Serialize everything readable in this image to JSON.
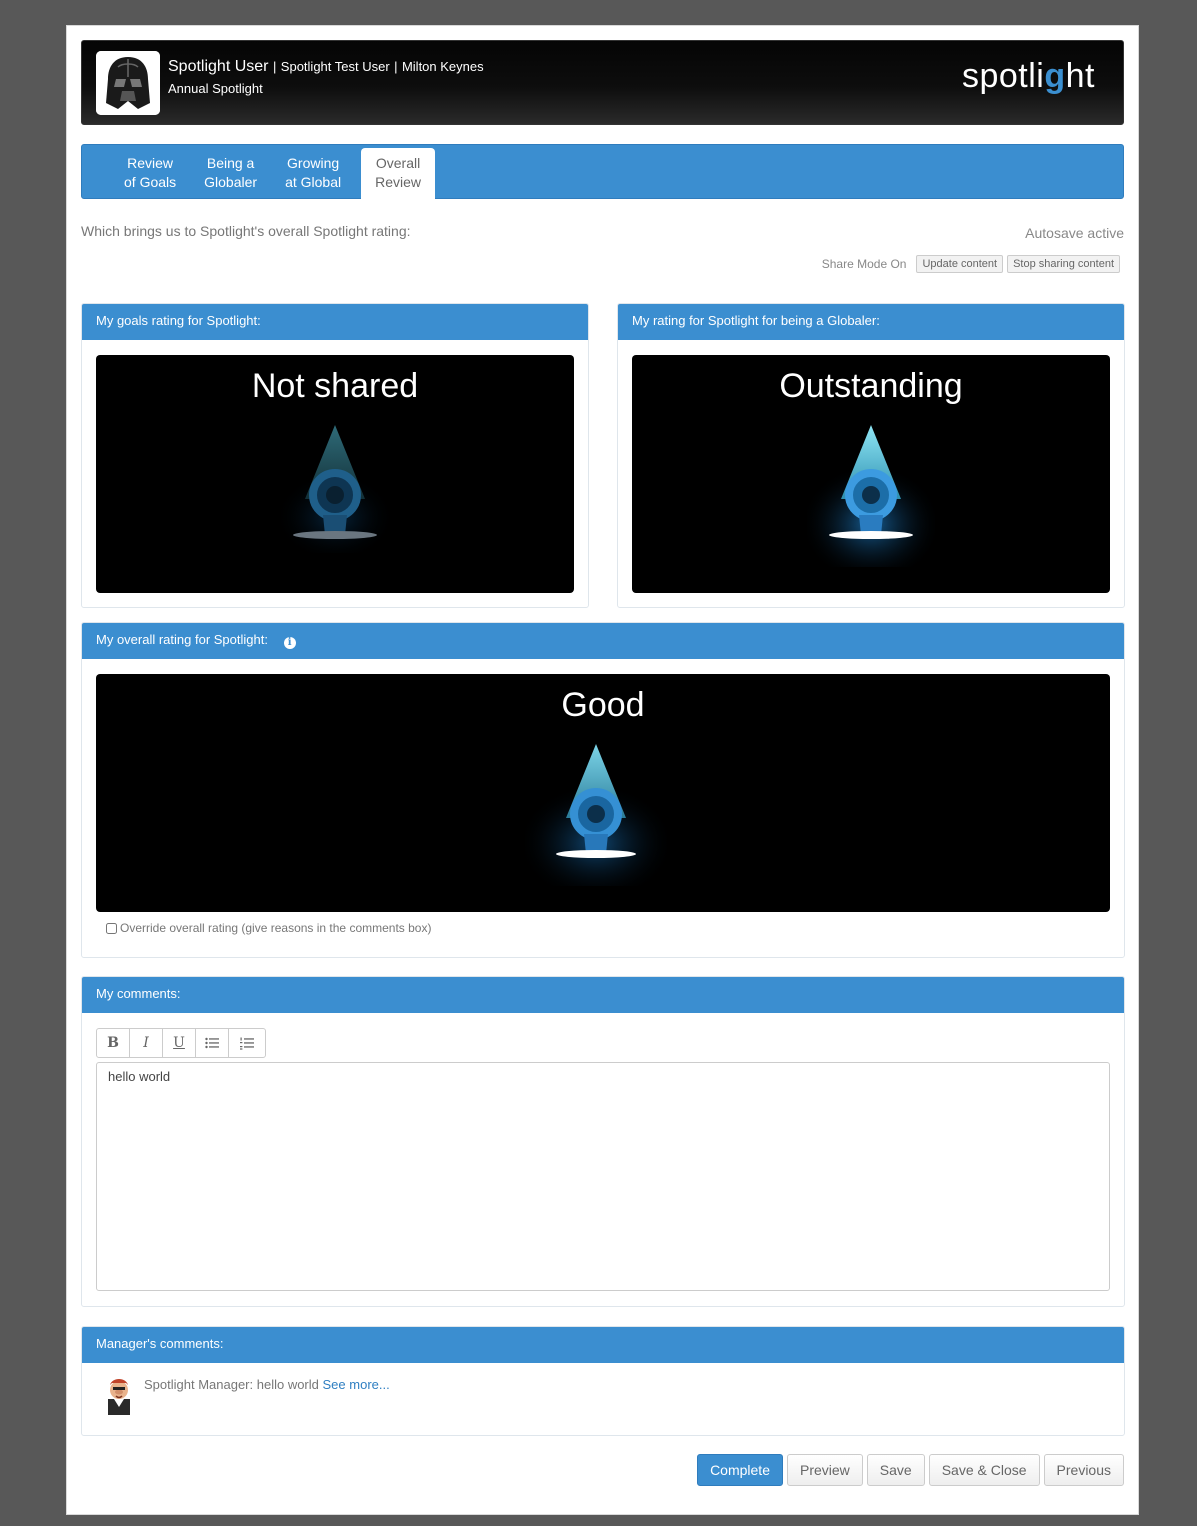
{
  "header": {
    "user_name": "Spotlight User",
    "test_user": "Spotlight Test User",
    "location": "Milton Keynes",
    "separator": "|",
    "review_type": "Annual Spotlight",
    "logo_left": "spotli",
    "logo_g": "g",
    "logo_right": "ht"
  },
  "tabs": [
    {
      "line1": "Review",
      "line2": "of Goals"
    },
    {
      "line1": "Being a",
      "line2": "Globaler"
    },
    {
      "line1": "Growing",
      "line2": "at Global"
    },
    {
      "line1": "Overall",
      "line2": "Review",
      "active": true
    }
  ],
  "intro_text": "Which brings us to Spotlight's overall Spotlight rating:",
  "autosave": "Autosave active",
  "share": {
    "label": "Share Mode On",
    "update_label": "Update content",
    "stop_label": "Stop sharing content"
  },
  "goals_panel": {
    "title": "My goals rating for Spotlight:",
    "rating": "Not shared"
  },
  "globaler_panel": {
    "title": "My rating for Spotlight for being a Globaler:",
    "rating": "Outstanding"
  },
  "overall_panel": {
    "title": "My overall rating for Spotlight:",
    "info_icon": "info-icon",
    "rating": "Good",
    "override_label": "Override overall rating (give reasons in the comments box)"
  },
  "comments_panel": {
    "title": "My comments:",
    "toolbar": [
      "B",
      "I",
      "U"
    ],
    "text": "hello world"
  },
  "manager_panel": {
    "title": "Manager's comments:",
    "comment": "Spotlight Manager: hello world",
    "see_more": "See more..."
  },
  "actions": {
    "complete": "Complete",
    "preview": "Preview",
    "save": "Save",
    "save_close": "Save & Close",
    "previous": "Previous"
  },
  "colors": {
    "accent": "#3b8ed0",
    "background": "#585858"
  }
}
